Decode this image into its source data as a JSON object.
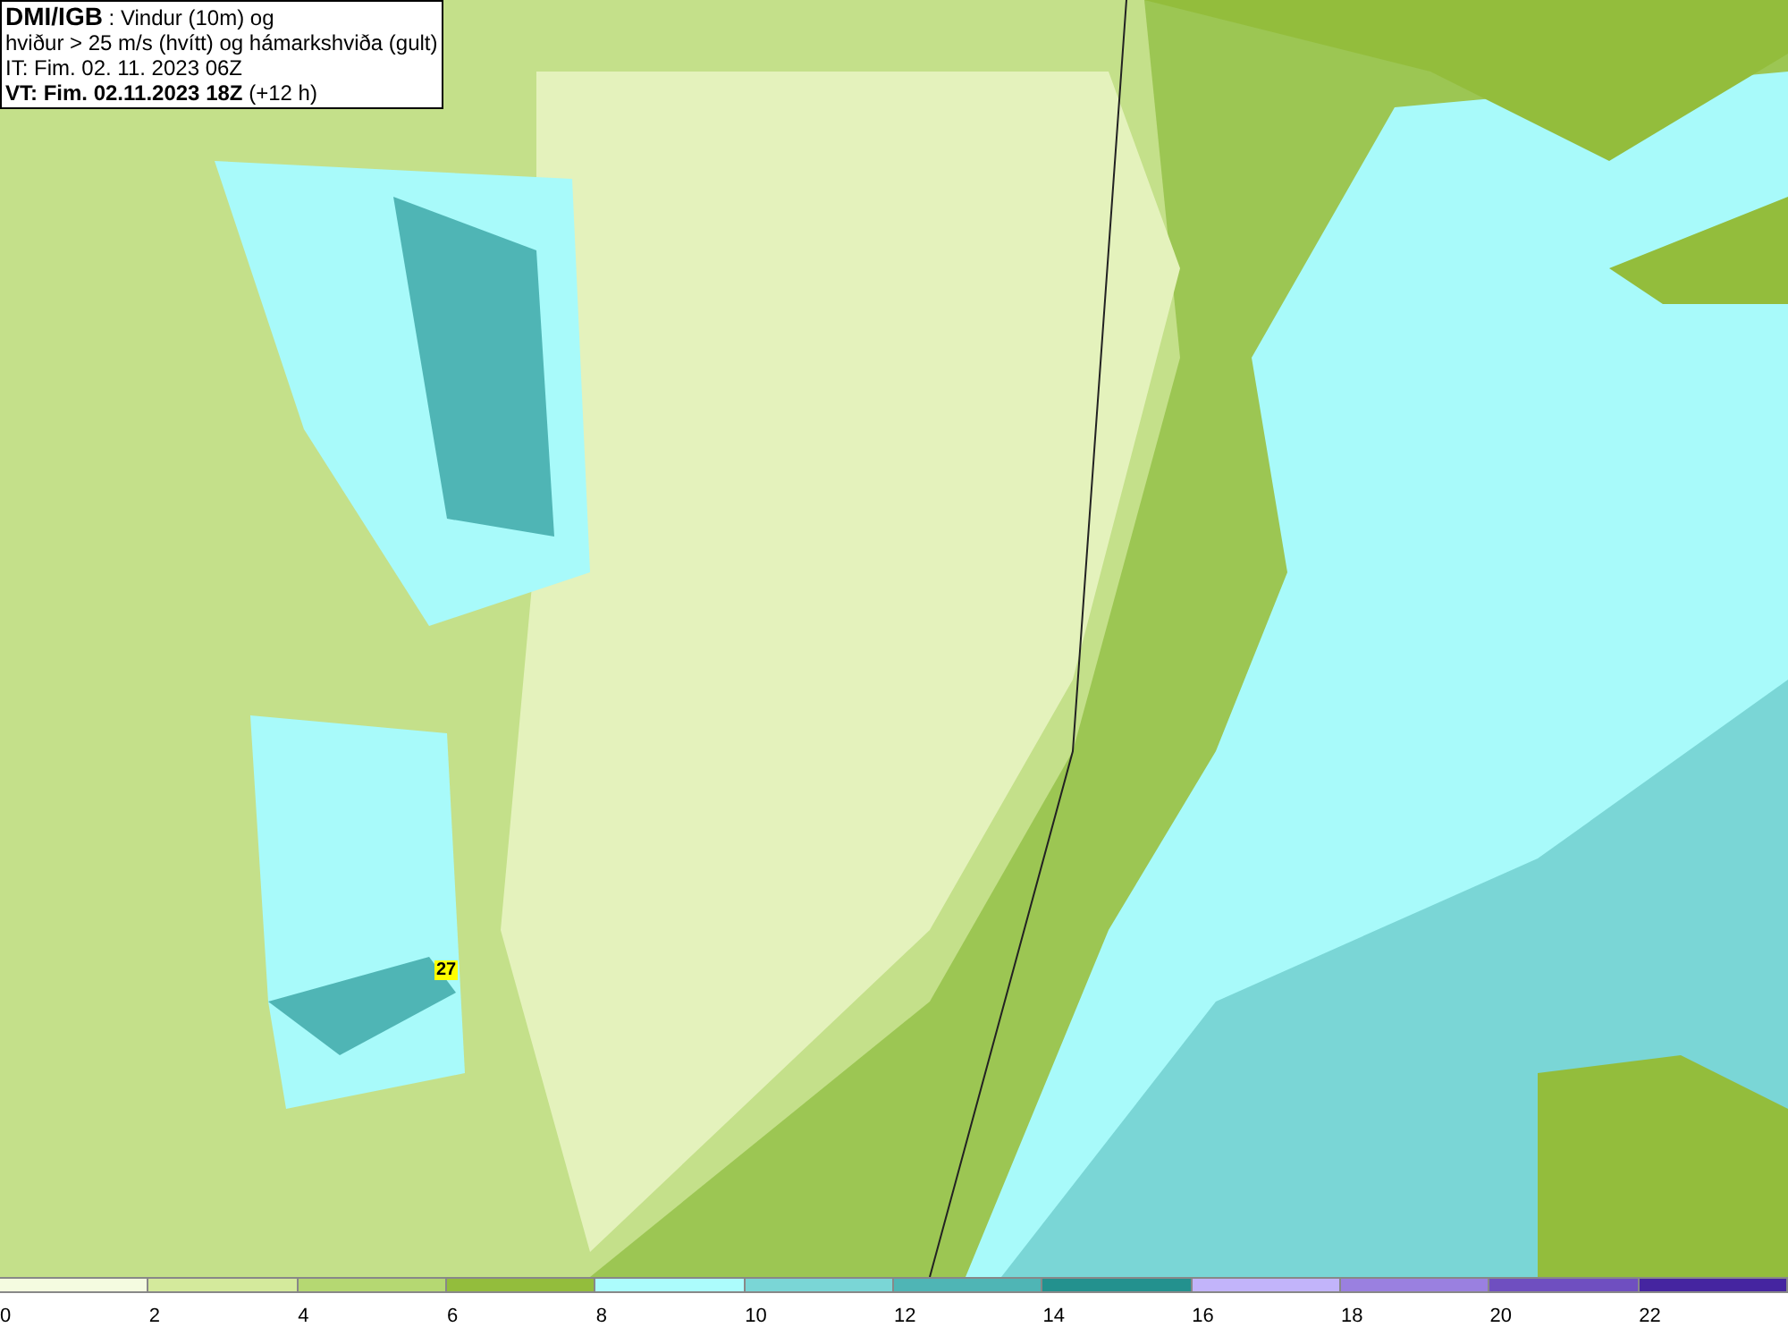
{
  "header": {
    "source": "DMI/IGB",
    "title": " : Vindur (10m) og",
    "subtitle": "hviður > 25 m/s (hvítt) og hámarkshviða (gult)",
    "issue_time": "IT: Fim. 02. 11. 2023 06Z",
    "valid_time": "VT: Fim. 02.11.2023 18Z",
    "lead": " (+12 h)"
  },
  "map": {
    "gust_label": "27"
  },
  "legend": {
    "bins": [
      {
        "color": "#f4fbe0"
      },
      {
        "color": "#d4ea9c"
      },
      {
        "color": "#b5d872"
      },
      {
        "color": "#93bd3c"
      },
      {
        "color": "#acfcfc"
      },
      {
        "color": "#7ad6d6"
      },
      {
        "color": "#4fb5b5"
      },
      {
        "color": "#23918e"
      },
      {
        "color": "#c2b4fa"
      },
      {
        "color": "#9a80e0"
      },
      {
        "color": "#6f4fc0"
      },
      {
        "color": "#4525a0"
      }
    ],
    "ticks": [
      "0",
      "2",
      "4",
      "6",
      "8",
      "10",
      "12",
      "14",
      "16",
      "18",
      "20",
      "22"
    ]
  }
}
